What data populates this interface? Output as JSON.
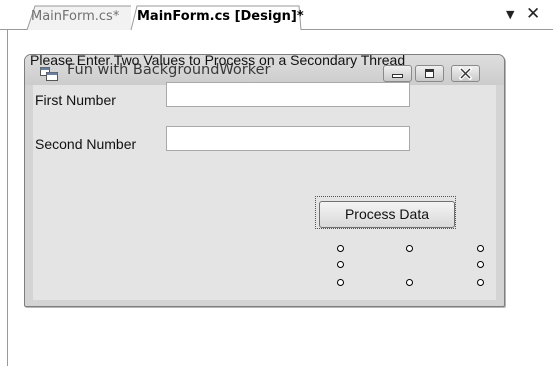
{
  "tabs": [
    {
      "label": "MainForm.cs*",
      "active": false
    },
    {
      "label": "MainForm.cs [Design]*",
      "active": true
    }
  ],
  "tab_controls": {
    "menu_icon": "dropdown-arrow-icon",
    "close_icon": "close-icon"
  },
  "form": {
    "title": "Fun with BackgroundWorker",
    "caption_buttons": [
      "minimize-icon",
      "maximize-icon",
      "close-icon"
    ],
    "heading": "Please Enter Two Values to Process on a Secondary Thread",
    "first_label": "First Number",
    "first_value": "",
    "second_label": "Second Number",
    "second_value": "",
    "process_button": "Process Data"
  },
  "colors": {
    "form_chrome": "#d4d4d4",
    "client_area": "#e4e4e4",
    "selection": "#555555"
  }
}
